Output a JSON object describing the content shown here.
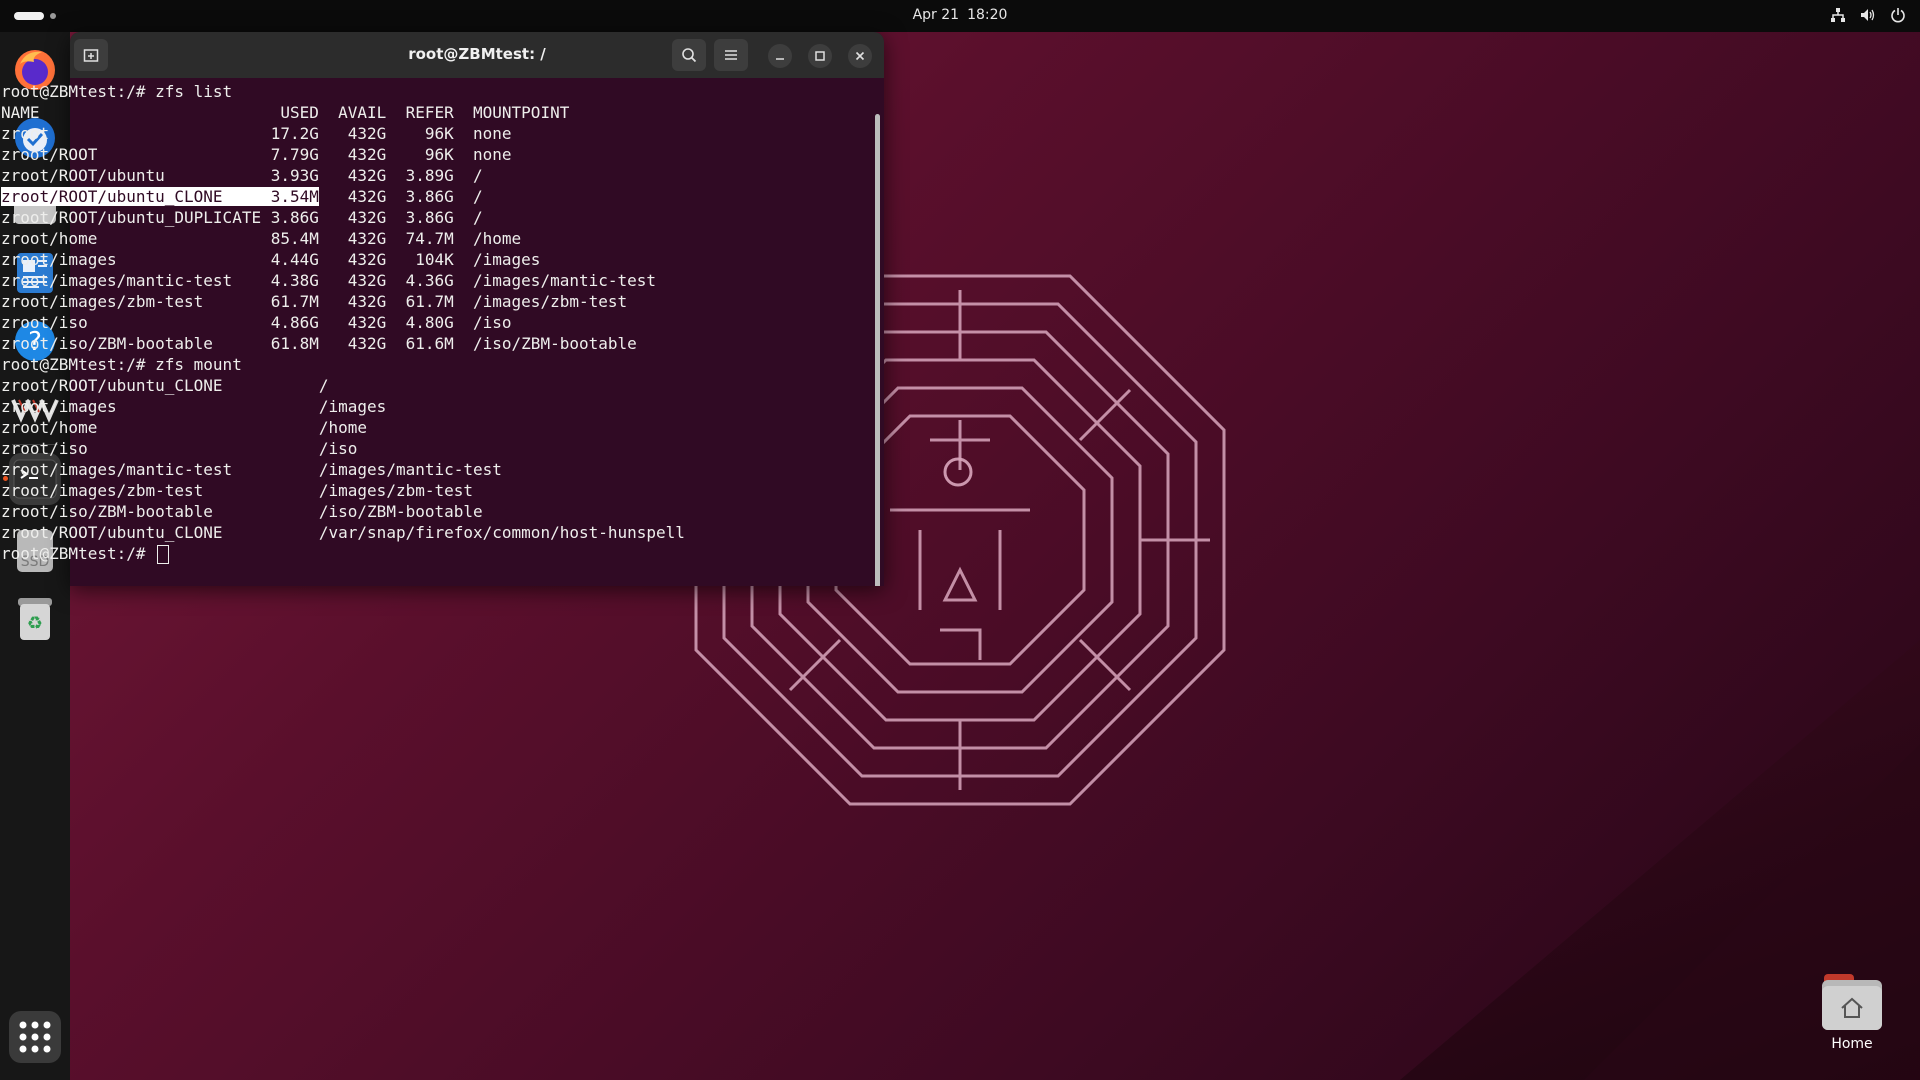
{
  "topbar": {
    "date": "Apr 21",
    "time": "18:20"
  },
  "dock": {
    "items": [
      {
        "name": "firefox"
      },
      {
        "name": "thunderbird"
      },
      {
        "name": "files"
      },
      {
        "name": "libreoffice-writer"
      },
      {
        "name": "help"
      },
      {
        "name": "virt-manager"
      },
      {
        "name": "terminal"
      },
      {
        "name": "ssd-drive",
        "label": "SSD"
      },
      {
        "name": "trash"
      },
      {
        "name": "show-apps"
      }
    ]
  },
  "terminal": {
    "title": "root@ZBMtest: /",
    "prompt_final": "root@ZBMtest:/# ",
    "lines": [
      "root@ZBMtest:/# zfs list",
      "NAME                         USED  AVAIL  REFER  MOUNTPOINT",
      "zroot                       17.2G   432G    96K  none",
      "zroot/ROOT                  7.79G   432G    96K  none",
      "zroot/ROOT/ubuntu           3.93G   432G  3.89G  /",
      "zroot/ROOT/ubuntu_CLONE     3.54M   432G  3.86G  /",
      "zroot/ROOT/ubuntu_DUPLICATE 3.86G   432G  3.86G  /",
      "zroot/home                  85.4M   432G  74.7M  /home",
      "zroot/images                4.44G   432G   104K  /images",
      "zroot/images/mantic-test    4.38G   432G  4.36G  /images/mantic-test",
      "zroot/images/zbm-test       61.7M   432G  61.7M  /images/zbm-test",
      "zroot/iso                   4.86G   432G  4.80G  /iso",
      "zroot/iso/ZBM-bootable      61.8M   432G  61.6M  /iso/ZBM-bootable",
      "root@ZBMtest:/# zfs mount",
      "zroot/ROOT/ubuntu_CLONE          /",
      "zroot/images                     /images",
      "zroot/home                       /home",
      "zroot/iso                        /iso",
      "zroot/images/mantic-test         /images/mantic-test",
      "zroot/images/zbm-test            /images/zbm-test",
      "zroot/iso/ZBM-bootable           /iso/ZBM-bootable",
      "zroot/ROOT/ubuntu_CLONE          /var/snap/firefox/common/host-hunspell"
    ],
    "selected_text": "zroot/ROOT/ubuntu_CLONE     3.54M",
    "selected_rest": "   432G  3.86G  /"
  },
  "desktop": {
    "home_label": "Home"
  },
  "colors": {
    "terminal_bg": "#300a24",
    "accent": "#e95420"
  }
}
